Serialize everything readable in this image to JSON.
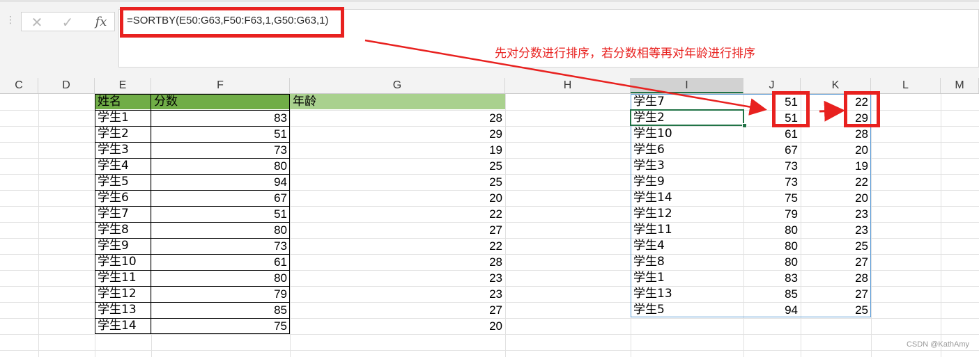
{
  "formula_bar": {
    "cancel_icon": "✕",
    "enter_icon": "✓",
    "fx_label": "fx",
    "formula": "=SORTBY(E50:G63,F50:F63,1,G50:G63,1)"
  },
  "annotation": "先对分数进行排序，若分数相等再对年龄进行排序",
  "columns": [
    "C",
    "D",
    "E",
    "F",
    "G",
    "H",
    "I",
    "J",
    "K",
    "L",
    "M"
  ],
  "selected_column": "I",
  "source_table": {
    "headers": [
      "姓名",
      "分数",
      "年龄"
    ],
    "rows": [
      [
        "学生1",
        "83",
        "28"
      ],
      [
        "学生2",
        "51",
        "29"
      ],
      [
        "学生3",
        "73",
        "19"
      ],
      [
        "学生4",
        "80",
        "25"
      ],
      [
        "学生5",
        "94",
        "25"
      ],
      [
        "学生6",
        "67",
        "20"
      ],
      [
        "学生7",
        "51",
        "22"
      ],
      [
        "学生8",
        "80",
        "27"
      ],
      [
        "学生9",
        "73",
        "22"
      ],
      [
        "学生10",
        "61",
        "28"
      ],
      [
        "学生11",
        "80",
        "23"
      ],
      [
        "学生12",
        "79",
        "23"
      ],
      [
        "学生13",
        "85",
        "27"
      ],
      [
        "学生14",
        "75",
        "20"
      ]
    ]
  },
  "sorted_table": {
    "rows": [
      [
        "学生7",
        "51",
        "22"
      ],
      [
        "学生2",
        "51",
        "29"
      ],
      [
        "学生10",
        "61",
        "28"
      ],
      [
        "学生6",
        "67",
        "20"
      ],
      [
        "学生3",
        "73",
        "19"
      ],
      [
        "学生9",
        "73",
        "22"
      ],
      [
        "学生14",
        "75",
        "20"
      ],
      [
        "学生12",
        "79",
        "23"
      ],
      [
        "学生11",
        "80",
        "23"
      ],
      [
        "学生4",
        "80",
        "25"
      ],
      [
        "学生8",
        "80",
        "27"
      ],
      [
        "学生1",
        "83",
        "28"
      ],
      [
        "学生13",
        "85",
        "27"
      ],
      [
        "学生5",
        "94",
        "25"
      ]
    ]
  },
  "colors": {
    "highlight_red": "#e8211f",
    "header_green_dark": "#70ad47",
    "header_green_light": "#a9d18e",
    "spill_border_blue": "#5b9bd5",
    "active_cell_green": "#217346"
  },
  "watermark": "CSDN @KathAmy"
}
